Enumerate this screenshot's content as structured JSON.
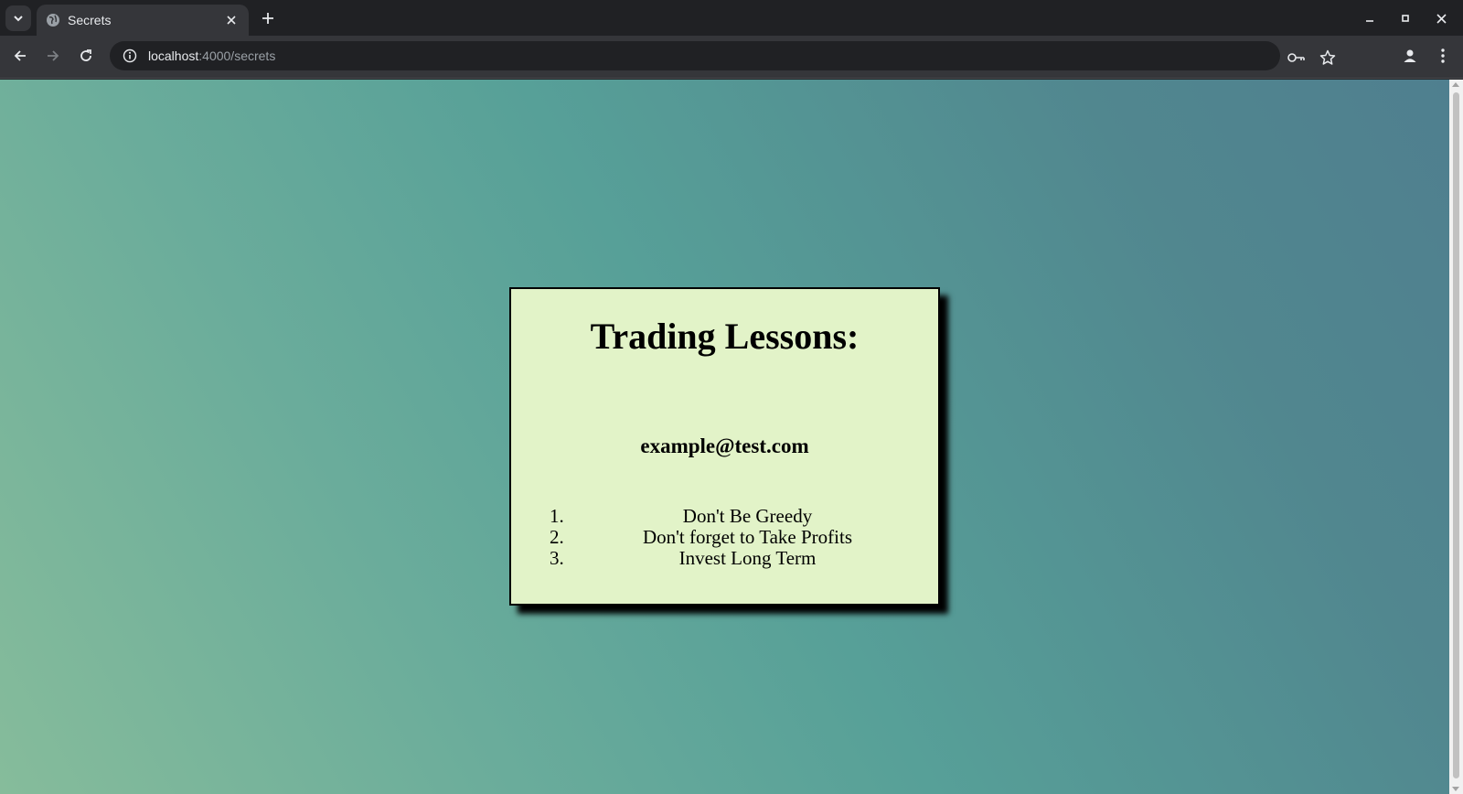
{
  "browser": {
    "tab": {
      "title": "Secrets"
    },
    "address": {
      "host": "localhost",
      "rest": ":4000/secrets"
    }
  },
  "page": {
    "heading": "Trading Lessons:",
    "email": "example@test.com",
    "lessons": [
      {
        "num": "1.",
        "text": "Don't Be Greedy"
      },
      {
        "num": "2.",
        "text": "Don't forget to Take Profits"
      },
      {
        "num": "3.",
        "text": "Invest Long Term"
      }
    ]
  },
  "colors": {
    "card_background": "#e2f3c8",
    "gradient_start": "#86bc9b",
    "gradient_end": "#4f7f8f"
  }
}
